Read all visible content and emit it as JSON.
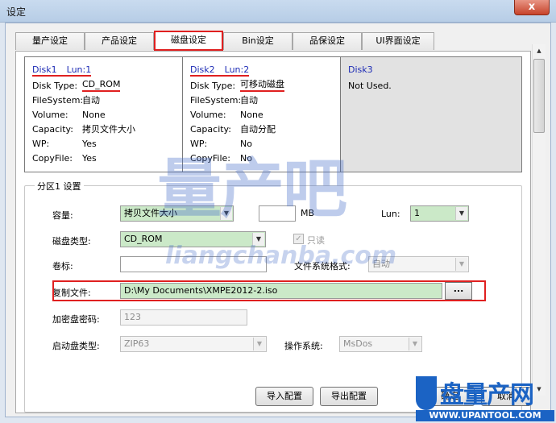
{
  "window": {
    "title": "设定",
    "close_glyph": "x"
  },
  "tabs": [
    {
      "label": "量产设定",
      "active": false
    },
    {
      "label": "产品设定",
      "active": false
    },
    {
      "label": "磁盘设定",
      "active": true
    },
    {
      "label": "Bin设定",
      "active": false
    },
    {
      "label": "品保设定",
      "active": false
    },
    {
      "label": "UI界面设定",
      "active": false
    }
  ],
  "disks": [
    {
      "name": "Disk1",
      "lun": "Lun:1",
      "rows": [
        {
          "k": "Disk Type:",
          "v": "CD_ROM"
        },
        {
          "k": "FileSystem:",
          "v": "自动"
        },
        {
          "k": "Volume:",
          "v": "None"
        },
        {
          "k": "Capacity:",
          "v": "拷贝文件大小"
        },
        {
          "k": "WP:",
          "v": "Yes"
        },
        {
          "k": "CopyFile:",
          "v": "Yes"
        }
      ]
    },
    {
      "name": "Disk2",
      "lun": "Lun:2",
      "rows": [
        {
          "k": "Disk Type:",
          "v": "可移动磁盘"
        },
        {
          "k": "FileSystem:",
          "v": "自动"
        },
        {
          "k": "Volume:",
          "v": "None"
        },
        {
          "k": "Capacity:",
          "v": "自动分配"
        },
        {
          "k": "WP:",
          "v": "No"
        },
        {
          "k": "CopyFile:",
          "v": "No"
        }
      ]
    },
    {
      "name": "Disk3",
      "status": "Not Used."
    }
  ],
  "partition": {
    "group_title": "分区1 设置",
    "capacity_label": "容量:",
    "capacity_value": "拷贝文件大小",
    "size_value": "",
    "size_unit": "MB",
    "lun_label": "Lun:",
    "lun_value": "1",
    "disk_type_label": "磁盘类型:",
    "disk_type_value": "CD_ROM",
    "readonly_label": "只读",
    "readonly_checked": true,
    "volume_label": "卷标:",
    "volume_value": "",
    "fs_label": "文件系统格式:",
    "fs_value": "自动",
    "copy_label": "复制文件:",
    "copy_value": "D:\\My Documents\\XMPE2012-2.iso",
    "browse_label": "...",
    "pwd_label": "加密盘密码:",
    "pwd_value": "123",
    "boot_label": "启动盘类型:",
    "boot_value": "ZIP63",
    "os_label": "操作系统:",
    "os_value": "MsDos"
  },
  "buttons": {
    "import": "导入配置",
    "export": "导出配置",
    "ok": "确定",
    "cancel": "取消"
  },
  "watermark": {
    "text": "量产吧",
    "url": "liangchanba.com"
  },
  "logo": {
    "cn": "盘量产网",
    "domain": "WWW.UPANTOOL.COM"
  },
  "colors": {
    "highlight_red": "#e02020",
    "input_green": "#cbe9c8",
    "disk_label_blue": "#1d2bb5"
  }
}
